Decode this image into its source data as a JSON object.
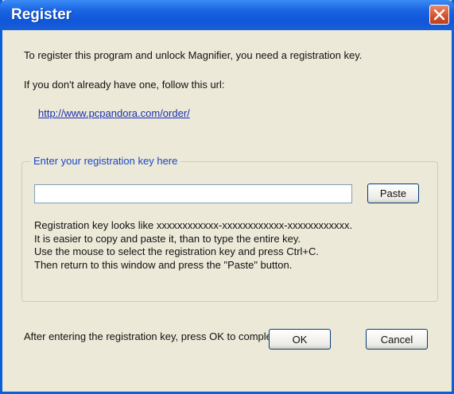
{
  "window": {
    "title": "Register",
    "close_label": "close"
  },
  "intro": {
    "line1": "To register this program and unlock Magnifier, you need a registration key.",
    "line2": "If you don't already have one, follow this url:",
    "url": "http://www.pcpandora.com/order/"
  },
  "group": {
    "title": "Enter your registration key here",
    "input_value": "",
    "paste_label": "Paste",
    "info_lines": [
      "Registration key looks like xxxxxxxxxxxx-xxxxxxxxxxxx-xxxxxxxxxxxx.",
      "It is easier to copy and paste it, than to type the entire key.",
      "Use the mouse to select the registration key and press Ctrl+C.",
      "Then return to this window and press the \"Paste\" button."
    ]
  },
  "footer": {
    "note": "After entering the registration key, press OK to complete the",
    "ok_label": "OK",
    "cancel_label": "Cancel"
  }
}
